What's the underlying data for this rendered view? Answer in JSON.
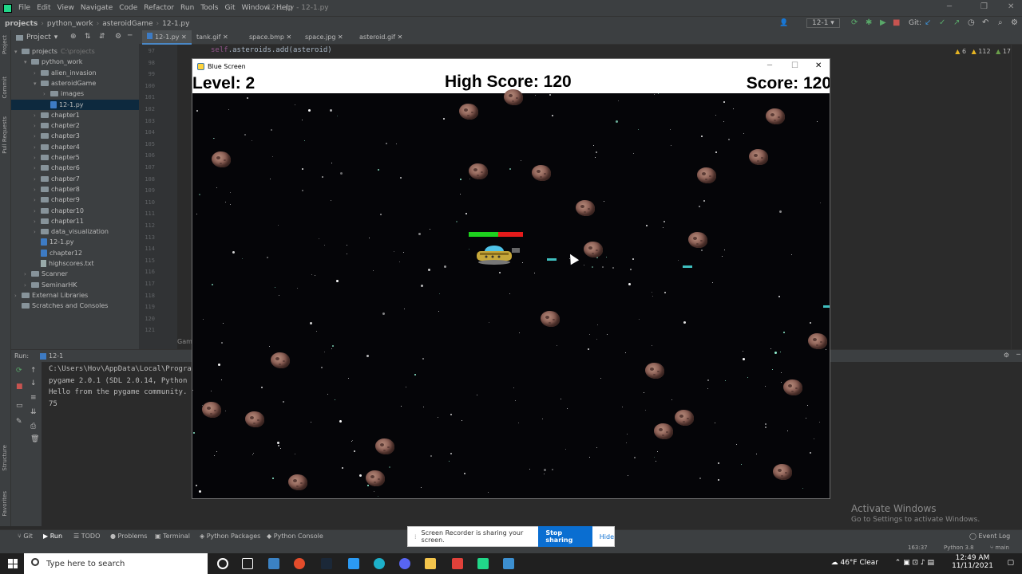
{
  "ide": {
    "menu": [
      "File",
      "Edit",
      "View",
      "Navigate",
      "Code",
      "Refactor",
      "Run",
      "Tools",
      "Git",
      "Window",
      "Help"
    ],
    "window_title": "12-1.py - 12-1.py",
    "breadcrumb": [
      "projects",
      "python_work",
      "asteroidGame",
      "12-1.py"
    ],
    "run_config": "12-1",
    "git_label": "Git:",
    "project_header": "Project",
    "tree": [
      {
        "label": "projects",
        "suffix": "C:\\projects",
        "depth": 0,
        "type": "folder",
        "expanded": true
      },
      {
        "label": "python_work",
        "depth": 1,
        "type": "folder",
        "expanded": true
      },
      {
        "label": "alien_invasion",
        "depth": 2,
        "type": "folder"
      },
      {
        "label": "asteroidGame",
        "depth": 2,
        "type": "folder",
        "expanded": true
      },
      {
        "label": "images",
        "depth": 3,
        "type": "folder"
      },
      {
        "label": "12-1.py",
        "depth": 3,
        "type": "py",
        "selected": true
      },
      {
        "label": "chapter1",
        "depth": 2,
        "type": "folder"
      },
      {
        "label": "chapter2",
        "depth": 2,
        "type": "folder"
      },
      {
        "label": "chapter3",
        "depth": 2,
        "type": "folder"
      },
      {
        "label": "chapter4",
        "depth": 2,
        "type": "folder"
      },
      {
        "label": "chapter5",
        "depth": 2,
        "type": "folder"
      },
      {
        "label": "chapter6",
        "depth": 2,
        "type": "folder"
      },
      {
        "label": "chapter7",
        "depth": 2,
        "type": "folder"
      },
      {
        "label": "chapter8",
        "depth": 2,
        "type": "folder"
      },
      {
        "label": "chapter9",
        "depth": 2,
        "type": "folder"
      },
      {
        "label": "chapter10",
        "depth": 2,
        "type": "folder"
      },
      {
        "label": "chapter11",
        "depth": 2,
        "type": "folder"
      },
      {
        "label": "data_visualization",
        "depth": 2,
        "type": "folder"
      },
      {
        "label": "12-1.py",
        "depth": 2,
        "type": "py"
      },
      {
        "label": "chapter12",
        "depth": 2,
        "type": "py"
      },
      {
        "label": "highscores.txt",
        "depth": 2,
        "type": "txt"
      },
      {
        "label": "Scanner",
        "depth": 1,
        "type": "folder"
      },
      {
        "label": "SeminarHK",
        "depth": 1,
        "type": "folder"
      },
      {
        "label": "External Libraries",
        "depth": 0,
        "type": "folder"
      },
      {
        "label": "Scratches and Consoles",
        "depth": 0,
        "type": "scratch"
      }
    ],
    "editor_tabs": [
      "12-1.py",
      "tank.gif",
      "space.bmp",
      "space.jpg",
      "asteroid.gif"
    ],
    "line_numbers": [
      "97",
      "98",
      "99",
      "100",
      "101",
      "102",
      "103",
      "104",
      "105",
      "106",
      "107",
      "108",
      "109",
      "110",
      "111",
      "112",
      "113",
      "114",
      "115",
      "116",
      "117",
      "118",
      "119",
      "120",
      "121"
    ],
    "code_line_self": "self",
    "code_line_rest": ".asteroids.add(asteroid)",
    "inspections": {
      "warnings": "6",
      "weak": "112",
      "typos": "17"
    },
    "run_label": "Run:",
    "run_tab": "12-1",
    "console": [
      "C:\\Users\\Hov\\AppData\\Local\\Progra",
      "pygame 2.0.1 (SDL 2.0.14, Python 3",
      "Hello from the pygame community.",
      "75"
    ],
    "gutter_hint": "Gam",
    "bottom_tabs": [
      "Git",
      "Run",
      "TODO",
      "Problems",
      "Terminal",
      "Python Packages",
      "Python Console"
    ],
    "event_log": "Event Log",
    "status": {
      "position": "163:37",
      "interpreter": "Python 3.8",
      "branch": "main"
    }
  },
  "activate_windows": {
    "title": "Activate Windows",
    "subtitle": "Go to Settings to activate Windows."
  },
  "recorder": {
    "message": "Screen Recorder is sharing your screen.",
    "stop": "Stop sharing",
    "hide": "Hide"
  },
  "taskbar": {
    "search_placeholder": "Type here to search",
    "weather": "46°F  Clear",
    "time": "12:49 AM",
    "date": "11/11/2021"
  },
  "game": {
    "window_title": "Blue Screen",
    "level_text": "Level: 2",
    "high_score_text": "High Score: 120",
    "score_text": "Score: 120",
    "player_health": 0.55
  }
}
